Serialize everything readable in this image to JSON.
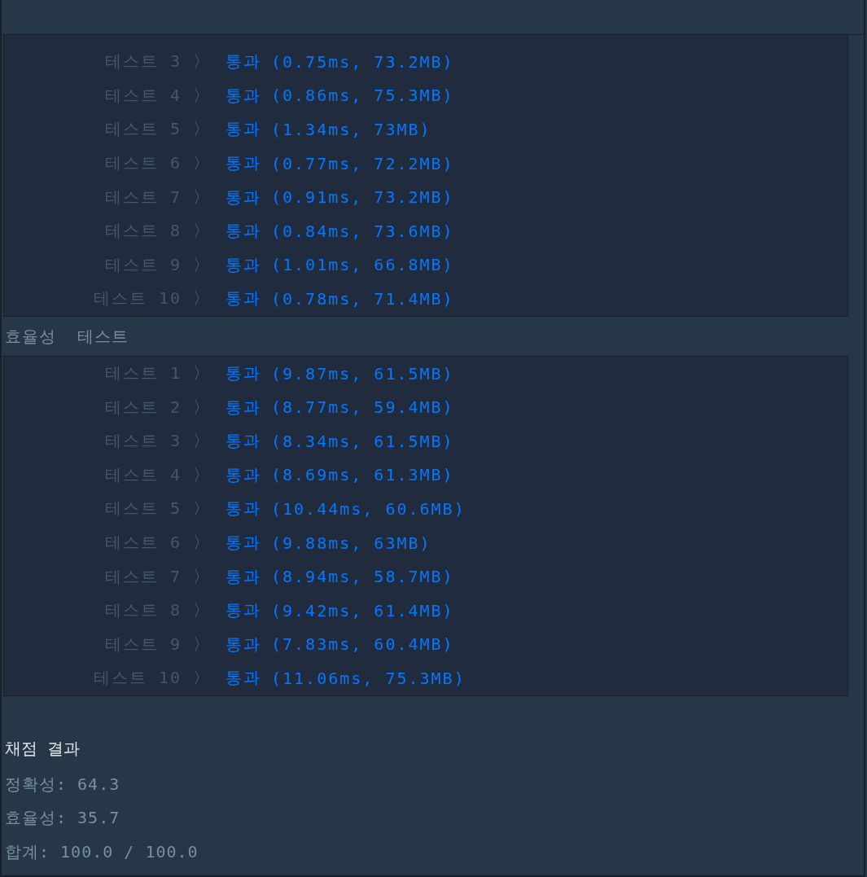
{
  "sections": [
    {
      "rows": [
        {
          "label": "테스트 3",
          "arrow": "〉",
          "status": "통과",
          "detail": "(0.75ms, 73.2MB)"
        },
        {
          "label": "테스트 4",
          "arrow": "〉",
          "status": "통과",
          "detail": "(0.86ms, 75.3MB)"
        },
        {
          "label": "테스트 5",
          "arrow": "〉",
          "status": "통과",
          "detail": "(1.34ms, 73MB)"
        },
        {
          "label": "테스트 6",
          "arrow": "〉",
          "status": "통과",
          "detail": "(0.77ms, 72.2MB)"
        },
        {
          "label": "테스트 7",
          "arrow": "〉",
          "status": "통과",
          "detail": "(0.91ms, 73.2MB)"
        },
        {
          "label": "테스트 8",
          "arrow": "〉",
          "status": "통과",
          "detail": "(0.84ms, 73.6MB)"
        },
        {
          "label": "테스트 9",
          "arrow": "〉",
          "status": "통과",
          "detail": "(1.01ms, 66.8MB)"
        },
        {
          "label": "테스트 10",
          "arrow": "〉",
          "status": "통과",
          "detail": "(0.78ms, 71.4MB)"
        }
      ]
    },
    {
      "title": "효율성  테스트",
      "rows": [
        {
          "label": "테스트 1",
          "arrow": "〉",
          "status": "통과",
          "detail": "(9.87ms, 61.5MB)"
        },
        {
          "label": "테스트 2",
          "arrow": "〉",
          "status": "통과",
          "detail": "(8.77ms, 59.4MB)"
        },
        {
          "label": "테스트 3",
          "arrow": "〉",
          "status": "통과",
          "detail": "(8.34ms, 61.5MB)"
        },
        {
          "label": "테스트 4",
          "arrow": "〉",
          "status": "통과",
          "detail": "(8.69ms, 61.3MB)"
        },
        {
          "label": "테스트 5",
          "arrow": "〉",
          "status": "통과",
          "detail": "(10.44ms, 60.6MB)"
        },
        {
          "label": "테스트 6",
          "arrow": "〉",
          "status": "통과",
          "detail": "(9.88ms, 63MB)"
        },
        {
          "label": "테스트 7",
          "arrow": "〉",
          "status": "통과",
          "detail": "(8.94ms, 58.7MB)"
        },
        {
          "label": "테스트 8",
          "arrow": "〉",
          "status": "통과",
          "detail": "(9.42ms, 61.4MB)"
        },
        {
          "label": "테스트 9",
          "arrow": "〉",
          "status": "통과",
          "detail": "(7.83ms, 60.4MB)"
        },
        {
          "label": "테스트 10",
          "arrow": "〉",
          "status": "통과",
          "detail": "(11.06ms, 75.3MB)"
        }
      ]
    }
  ],
  "result": {
    "title": "채점 결과",
    "lines": [
      "정확성: 64.3",
      "효율성: 35.7",
      "합계: 100.0 / 100.0"
    ]
  }
}
